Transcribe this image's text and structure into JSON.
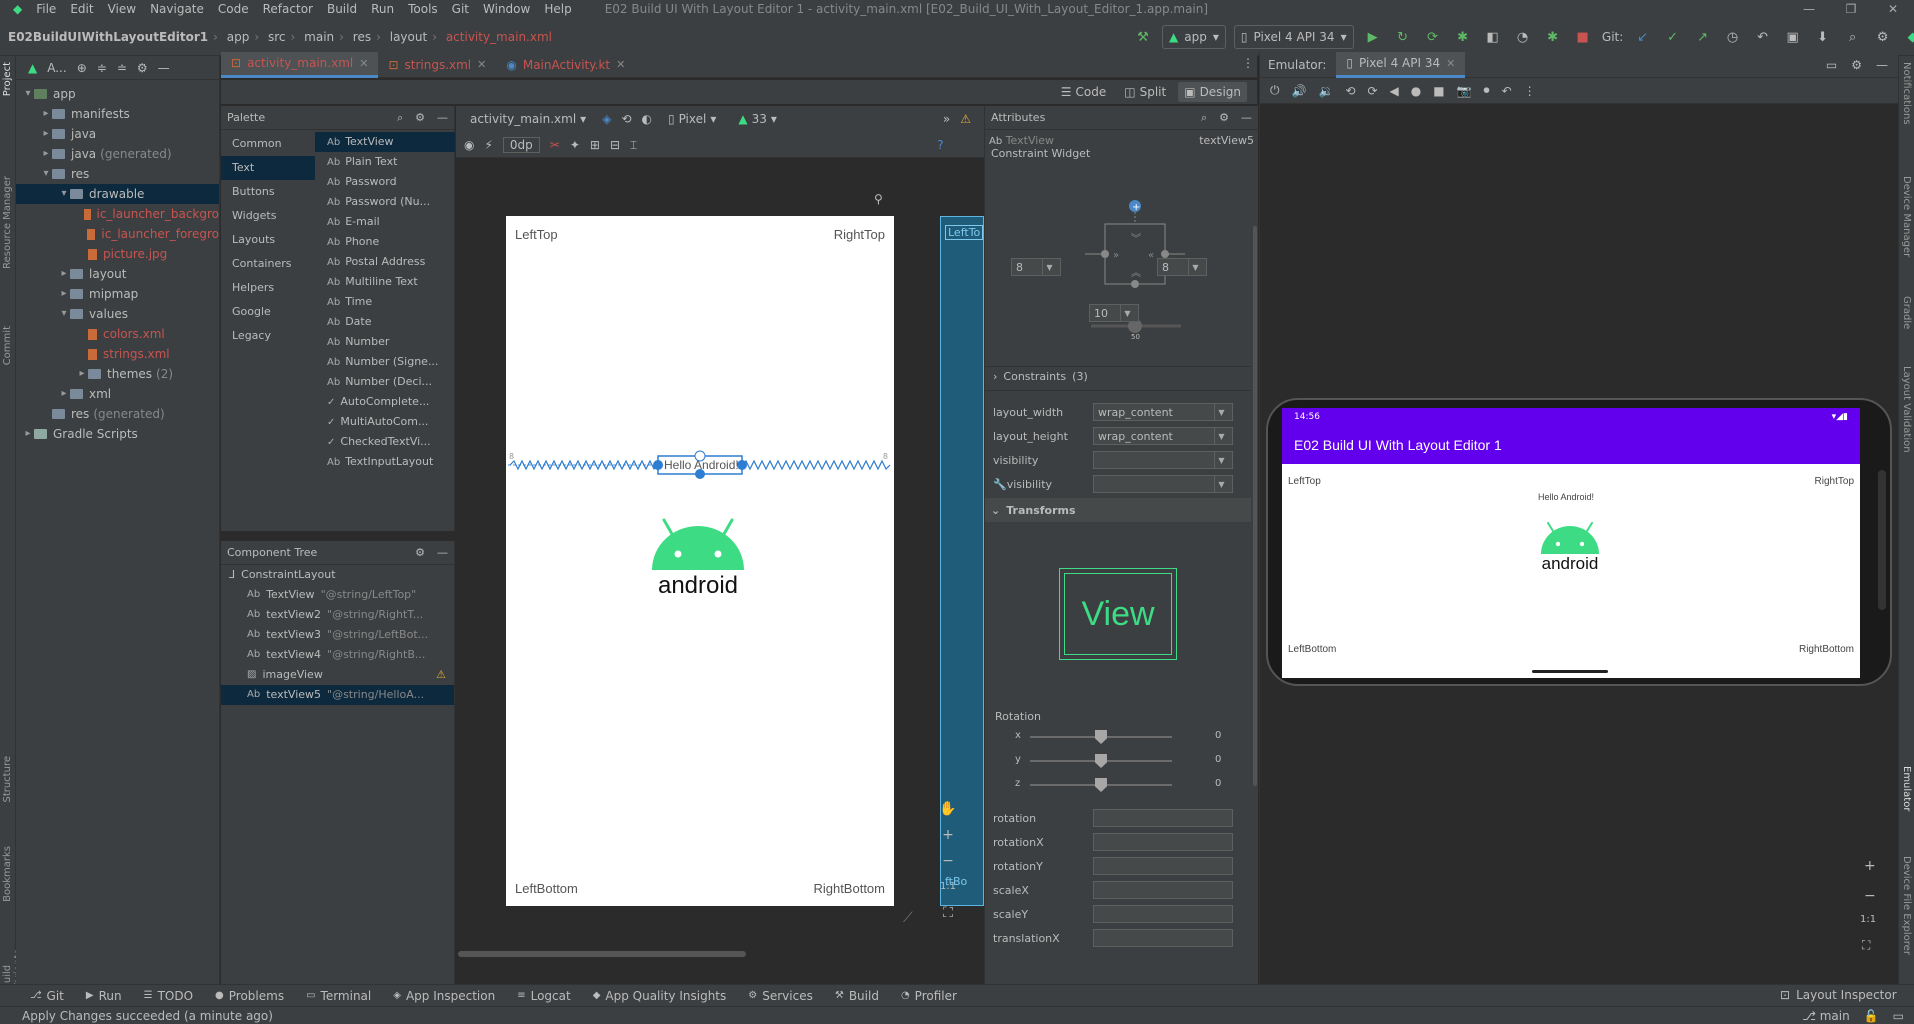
{
  "menu": {
    "items": [
      "File",
      "Edit",
      "View",
      "Navigate",
      "Code",
      "Refactor",
      "Build",
      "Run",
      "Tools",
      "Git",
      "Window",
      "Help"
    ],
    "window_title": "E02 Build UI With Layout Editor 1 - activity_main.xml [E02_Build_UI_With_Layout_Editor_1.app.main]"
  },
  "breadcrumb": {
    "project": "E02BuildUIWithLayoutEditor1",
    "parts": [
      "app",
      "src",
      "main",
      "res",
      "layout"
    ],
    "file": "activity_main.xml"
  },
  "toolbar": {
    "run_config": "app",
    "device": "Pixel 4 API 34",
    "git_label": "Git:"
  },
  "project_panel": {
    "title": "A...",
    "tree": [
      {
        "label": "app",
        "indent": 0,
        "arrow": "▾",
        "icon": "app"
      },
      {
        "label": "manifests",
        "indent": 1,
        "arrow": "▸",
        "icon": "folder"
      },
      {
        "label": "java",
        "indent": 1,
        "arrow": "▸",
        "icon": "folder"
      },
      {
        "label": "java",
        "suffix": "(generated)",
        "indent": 1,
        "arrow": "▸",
        "icon": "folder"
      },
      {
        "label": "res",
        "indent": 1,
        "arrow": "▾",
        "icon": "folder"
      },
      {
        "label": "drawable",
        "indent": 2,
        "arrow": "▾",
        "icon": "folder",
        "selected": true
      },
      {
        "label": "ic_launcher_backgro",
        "indent": 3,
        "arrow": "",
        "icon": "file",
        "red": true
      },
      {
        "label": "ic_launcher_foregro",
        "indent": 3,
        "arrow": "",
        "icon": "file",
        "red": true
      },
      {
        "label": "picture.jpg",
        "indent": 3,
        "arrow": "",
        "icon": "file",
        "red": true
      },
      {
        "label": "layout",
        "indent": 2,
        "arrow": "▸",
        "icon": "folder"
      },
      {
        "label": "mipmap",
        "indent": 2,
        "arrow": "▸",
        "icon": "folder"
      },
      {
        "label": "values",
        "indent": 2,
        "arrow": "▾",
        "icon": "folder"
      },
      {
        "label": "colors.xml",
        "indent": 3,
        "arrow": "",
        "icon": "file",
        "red": true
      },
      {
        "label": "strings.xml",
        "indent": 3,
        "arrow": "",
        "icon": "file",
        "red": true
      },
      {
        "label": "themes",
        "suffix": "(2)",
        "indent": 3,
        "arrow": "▸",
        "icon": "folder"
      },
      {
        "label": "xml",
        "indent": 2,
        "arrow": "▸",
        "icon": "folder"
      },
      {
        "label": "res",
        "suffix": "(generated)",
        "indent": 1,
        "arrow": "",
        "icon": "folder"
      },
      {
        "label": "Gradle Scripts",
        "indent": 0,
        "arrow": "▸",
        "icon": "gradle"
      }
    ]
  },
  "left_strip": [
    "Project",
    "Resource Manager",
    "Commit",
    "Structure",
    "Bookmarks",
    "Build Variants"
  ],
  "right_strip": [
    "Notifications",
    "Device Manager",
    "Gradle",
    "Layout Validation",
    "Emulator",
    "Device File Explorer"
  ],
  "editor_tabs": [
    {
      "label": "activity_main.xml",
      "active": true,
      "red": true
    },
    {
      "label": "strings.xml",
      "active": false,
      "red": true
    },
    {
      "label": "MainActivity.kt",
      "active": false,
      "red": true
    }
  ],
  "view_modes": {
    "code": "Code",
    "split": "Split",
    "design": "Design"
  },
  "palette": {
    "title": "Palette",
    "categories": [
      "Common",
      "Text",
      "Buttons",
      "Widgets",
      "Layouts",
      "Containers",
      "Helpers",
      "Google",
      "Legacy"
    ],
    "active_category": "Text",
    "items": [
      {
        "label": "TextView",
        "prefix": "Ab"
      },
      {
        "label": "Plain Text",
        "prefix": "Ab"
      },
      {
        "label": "Password",
        "prefix": "Ab"
      },
      {
        "label": "Password (Nu...",
        "prefix": "Ab"
      },
      {
        "label": "E-mail",
        "prefix": "Ab"
      },
      {
        "label": "Phone",
        "prefix": "Ab"
      },
      {
        "label": "Postal Address",
        "prefix": "Ab"
      },
      {
        "label": "Multiline Text",
        "prefix": "Ab"
      },
      {
        "label": "Time",
        "prefix": "Ab"
      },
      {
        "label": "Date",
        "prefix": "Ab"
      },
      {
        "label": "Number",
        "prefix": "Ab"
      },
      {
        "label": "Number (Signe...",
        "prefix": "Ab"
      },
      {
        "label": "Number (Deci...",
        "prefix": "Ab"
      },
      {
        "label": "AutoComplete...",
        "prefix": "✓"
      },
      {
        "label": "MultiAutoCom...",
        "prefix": "✓"
      },
      {
        "label": "CheckedTextVi...",
        "prefix": "✓"
      },
      {
        "label": "TextInputLayout",
        "prefix": "Ab"
      }
    ]
  },
  "component_tree": {
    "title": "Component Tree",
    "root": "ConstraintLayout",
    "items": [
      {
        "label": "TextView",
        "sub": "\"@string/LeftTop\"",
        "icon": "Ab"
      },
      {
        "label": "textView2",
        "sub": "\"@string/RightT...",
        "icon": "Ab"
      },
      {
        "label": "textView3",
        "sub": "\"@string/LeftBot...",
        "icon": "Ab"
      },
      {
        "label": "textView4",
        "sub": "\"@string/RightB...",
        "icon": "Ab"
      },
      {
        "label": "imageView",
        "sub": "",
        "icon": "img",
        "warn": true
      },
      {
        "label": "textView5",
        "sub": "\"@string/HelloA...",
        "icon": "Ab",
        "selected": true
      }
    ]
  },
  "canvas_toolbar": {
    "file": "activity_main.xml",
    "device": "Pixel",
    "api": "33",
    "margin": "0dp"
  },
  "design_surface": {
    "left_top": "LeftTop",
    "right_top": "RightTop",
    "left_bottom": "LeftBottom",
    "right_bottom": "RightBottom",
    "hello": "Hello Android!",
    "android_word": "android",
    "margin_left": "8",
    "margin_right": "8",
    "blueprint_top": "LeftTo",
    "blueprint_bottom": "ftBo",
    "zoom_ratio": "1:1"
  },
  "attributes": {
    "title": "Attributes",
    "widget_type": "TextView",
    "widget_id": "textView5",
    "constraint_title": "Constraint Widget",
    "margin_left": "8",
    "margin_right": "8",
    "margin_bottom": "10",
    "bias": "50",
    "constraints_label": "Constraints",
    "constraints_count": "(3)",
    "layout_width_label": "layout_width",
    "layout_width": "wrap_content",
    "layout_height_label": "layout_height",
    "layout_height": "wrap_content",
    "visibility_label": "visibility",
    "visibility2_label": "visibility",
    "transforms_label": "Transforms",
    "view_preview": "View",
    "rotation_label": "Rotation",
    "rot_x_label": "x",
    "rot_x": "0",
    "rot_y_label": "y",
    "rot_y": "0",
    "rot_z_label": "z",
    "rot_z": "0",
    "fields": [
      "rotation",
      "rotationX",
      "rotationY",
      "scaleX",
      "scaleY",
      "translationX"
    ]
  },
  "emulator": {
    "label": "Emulator:",
    "device_tab": "Pixel 4 API 34",
    "time": "14:56",
    "app_title": "E02 Build UI With Layout Editor 1",
    "left_top": "LeftTop",
    "right_top": "RightTop",
    "hello": "Hello Android!",
    "android_word": "android",
    "left_bottom": "LeftBottom",
    "right_bottom": "RightBottom",
    "zoom_ratio": "1:1"
  },
  "bottom_tools": [
    "Git",
    "Run",
    "TODO",
    "Problems",
    "Terminal",
    "App Inspection",
    "Logcat",
    "App Quality Insights",
    "Services",
    "Build",
    "Profiler"
  ],
  "layout_inspector": "Layout Inspector",
  "status": {
    "message": "Apply Changes succeeded (a minute ago)",
    "branch": "main"
  },
  "colors": {
    "accent_blue": "#4a88c7",
    "android_green": "#3ddc84",
    "app_purple": "#6200ee",
    "selection": "#0d293e"
  }
}
